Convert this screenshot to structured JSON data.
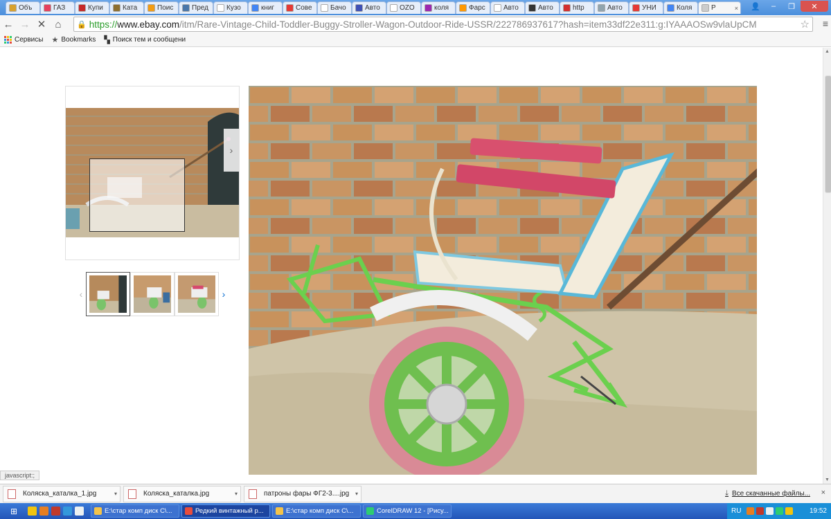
{
  "browser": {
    "tabs": [
      {
        "label": "Объ",
        "color": "#d8a12c"
      },
      {
        "label": "ГАЗ",
        "color": "#e5405e"
      },
      {
        "label": "Купи",
        "color": "#c62828"
      },
      {
        "label": "Ката",
        "color": "#8d6e2f"
      },
      {
        "label": "Поис",
        "color": "#f39c12"
      },
      {
        "label": "Пред",
        "color": "#4a76a8"
      },
      {
        "label": "Кузо",
        "color": "#ffffff"
      },
      {
        "label": "книг",
        "color": "#4285f4"
      },
      {
        "label": "Сове",
        "color": "#e53935"
      },
      {
        "label": "Бачо",
        "color": "#ffffff"
      },
      {
        "label": "Авто",
        "color": "#3f51b5"
      },
      {
        "label": "OZO",
        "color": "#ffffff"
      },
      {
        "label": "коля",
        "color": "#9c27b0"
      },
      {
        "label": "Фарс",
        "color": "#ff9800"
      },
      {
        "label": "Авто",
        "color": "#ffffff"
      },
      {
        "label": "Авто",
        "color": "#333333"
      },
      {
        "label": "http",
        "color": "#d32f2f"
      },
      {
        "label": "Авто",
        "color": "#90a4ae"
      },
      {
        "label": "УНИ",
        "color": "#e53935"
      },
      {
        "label": "Коля",
        "color": "#4285f4"
      },
      {
        "label": "Р",
        "color": "#cccccc",
        "active": true
      }
    ],
    "tab_close": "×",
    "window_controls": {
      "user": "👤",
      "minimize": "–",
      "maximize": "❐",
      "close": "✕"
    },
    "nav": {
      "back": "←",
      "forward": "→",
      "stop": "✕",
      "home": "⌂"
    },
    "url": {
      "scheme": "https://",
      "host": "www.ebay.com",
      "path": "/itm/Rare-Vintage-Child-Toddler-Buggy-Stroller-Wagon-Outdoor-Ride-USSR/222786937617?hash=item33df22e311:g:IYAAAOSw9vlaUpCM"
    },
    "bookmark_star": "☆",
    "menu": "≡",
    "bookmarks": [
      {
        "label": "Сервисы",
        "icon": "apps-icon"
      },
      {
        "label": "Bookmarks",
        "icon": "star-icon"
      },
      {
        "label": "Поиск тем и сообщени",
        "icon": "forum-icon"
      }
    ]
  },
  "gallery": {
    "zoom_next": "›",
    "thumb_prev": "‹",
    "thumb_next": "›",
    "thumbnails": 3,
    "selected_thumbnail": 1
  },
  "status_bar": {
    "text": "javascript:;"
  },
  "downloads": {
    "items": [
      {
        "name": "Коляска_каталка_1.jpg"
      },
      {
        "name": "Коляска_каталка.jpg"
      },
      {
        "name": "патроны фары ФГ2-3....jpg"
      }
    ],
    "arrow": "▾",
    "show_all": "Все скачанные файлы...",
    "close": "×"
  },
  "taskbar": {
    "start": "⊞",
    "tasks": [
      {
        "label": "E:\\стар комп диск C\\...",
        "color": "#f3c34a"
      },
      {
        "label": "Редкий винтажный р...",
        "color": "#e74c3c",
        "active": true
      },
      {
        "label": "E:\\стар комп диск C\\...",
        "color": "#f3c34a"
      },
      {
        "label": "CorelDRAW 12 - [Рису...",
        "color": "#2ecc71"
      }
    ],
    "lang": "RU",
    "clock": "19:52"
  }
}
